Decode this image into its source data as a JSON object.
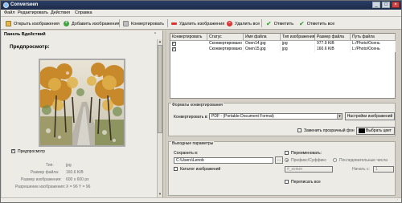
{
  "window": {
    "title": "Converseen"
  },
  "menu": [
    "Файл",
    "Редактировать",
    "Действия",
    "Справка"
  ],
  "toolbar": {
    "open_images": "Открыть изображения",
    "add_image": "Добавить изображения",
    "convert": "Конвертировать",
    "remove_images": "Удалить изображения",
    "remove_all": "Удалить все",
    "check": "Отметить",
    "check_all": "Отметить все"
  },
  "left_panel": {
    "title": "Панель Вдействий",
    "preview_label": "Предпросмотр:",
    "preview_checkbox": "Предпросмотр",
    "info": {
      "type_label": "Тип:",
      "type_value": "jpg",
      "filesize_label": "Размер файла:",
      "filesize_value": "160.6 KiB",
      "imagesize_label": "Размер изображения:",
      "imagesize_value": "600 x 600 px",
      "resolution_label": "Разрешение изображения:",
      "resolution_value": "X = 96 Y = 96"
    }
  },
  "table": {
    "headers": [
      "Конвертировать",
      "Статус",
      "Имя файла",
      "Тип изображения",
      "Размер файла",
      "Путь файла"
    ],
    "rows": [
      {
        "checked": true,
        "status": "Сконвертировано",
        "filename": "Osen14.jpg",
        "type": "jpg",
        "size": "977.9 KiB",
        "path": "L:/Photo/Осень"
      },
      {
        "checked": true,
        "status": "Сконвертировано",
        "filename": "Osen15.jpg",
        "type": "jpg",
        "size": "160.6 KiB",
        "path": "L:/Photo/Осень"
      }
    ]
  },
  "convert_formats": {
    "group_title": "Форматы конвертирования",
    "convert_to_label": "Конвертировать в:",
    "format_value": "PDF - (Portable Document Format)",
    "settings_button": "Настройки изображений",
    "replace_transparent": "Заменить прозрачный фон",
    "choose_color": "Выбрать цвет",
    "color_swatch": "#000000"
  },
  "output": {
    "group_title": "Выходные параметры",
    "save_in_label": "Сохранить в:",
    "save_path": "C:\\Users\\Lenob",
    "browse": "...",
    "images_dir": "Каталог изображений",
    "rename": "Переименовать:",
    "prefix_suffix": "Префикс/Суффикс",
    "progressive": "Последовательные числа",
    "pattern_value": "#_копия",
    "start_label": "Начать с:",
    "start_value": "1",
    "overwrite_all": "Переписать все"
  }
}
